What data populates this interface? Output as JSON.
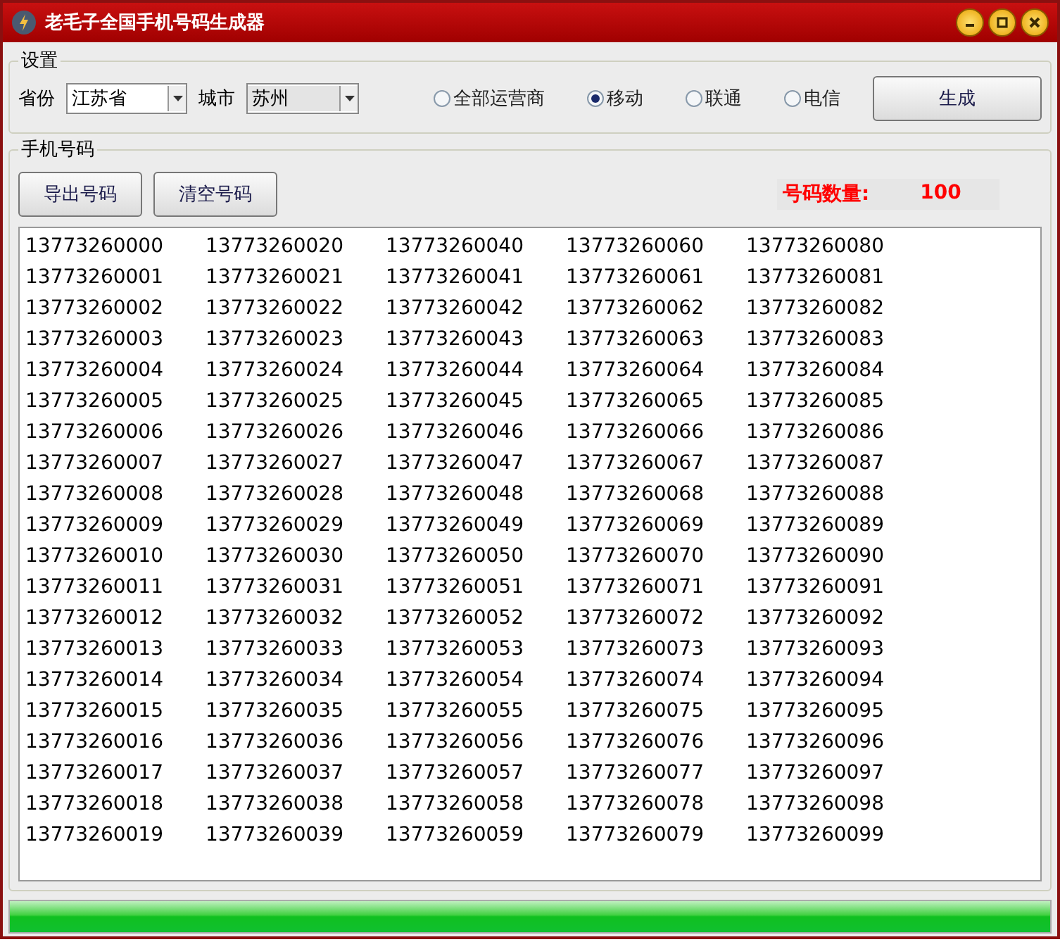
{
  "window": {
    "title": "老毛子全国手机号码生成器"
  },
  "settings": {
    "title": "设置",
    "province_label": "省份",
    "province": "江苏省",
    "city_label": "城市",
    "city": "苏州",
    "carriers": [
      {
        "label": "全部运营商",
        "selected": false
      },
      {
        "label": "移动",
        "selected": true
      },
      {
        "label": "联通",
        "selected": false
      },
      {
        "label": "电信",
        "selected": false
      }
    ],
    "generate_button": "生成"
  },
  "numbers_section": {
    "title": "手机号码",
    "buttons": [
      "导出号码",
      "清空号码"
    ],
    "count_label": "号码数量:",
    "count": "100",
    "numbers": [
      "13773260000",
      "13773260001",
      "13773260002",
      "13773260003",
      "13773260004",
      "13773260005",
      "13773260006",
      "13773260007",
      "13773260008",
      "13773260009",
      "13773260010",
      "13773260011",
      "13773260012",
      "13773260013",
      "13773260014",
      "13773260015",
      "13773260016",
      "13773260017",
      "13773260018",
      "13773260019",
      "13773260020",
      "13773260021",
      "13773260022",
      "13773260023",
      "13773260024",
      "13773260025",
      "13773260026",
      "13773260027",
      "13773260028",
      "13773260029",
      "13773260030",
      "13773260031",
      "13773260032",
      "13773260033",
      "13773260034",
      "13773260035",
      "13773260036",
      "13773260037",
      "13773260038",
      "13773260039",
      "13773260040",
      "13773260041",
      "13773260042",
      "13773260043",
      "13773260044",
      "13773260045",
      "13773260046",
      "13773260047",
      "13773260048",
      "13773260049",
      "13773260050",
      "13773260051",
      "13773260052",
      "13773260053",
      "13773260054",
      "13773260055",
      "13773260056",
      "13773260057",
      "13773260058",
      "13773260059",
      "13773260060",
      "13773260061",
      "13773260062",
      "13773260063",
      "13773260064",
      "13773260065",
      "13773260066",
      "13773260067",
      "13773260068",
      "13773260069",
      "13773260070",
      "13773260071",
      "13773260072",
      "13773260073",
      "13773260074",
      "13773260075",
      "13773260076",
      "13773260077",
      "13773260078",
      "13773260079",
      "13773260080",
      "13773260081",
      "13773260082",
      "13773260083",
      "13773260084",
      "13773260085",
      "13773260086",
      "13773260087",
      "13773260088",
      "13773260089",
      "13773260090",
      "13773260091",
      "13773260092",
      "13773260093",
      "13773260094",
      "13773260095",
      "13773260096",
      "13773260097",
      "13773260098",
      "13773260099"
    ]
  },
  "progress": {
    "level": 1
  }
}
